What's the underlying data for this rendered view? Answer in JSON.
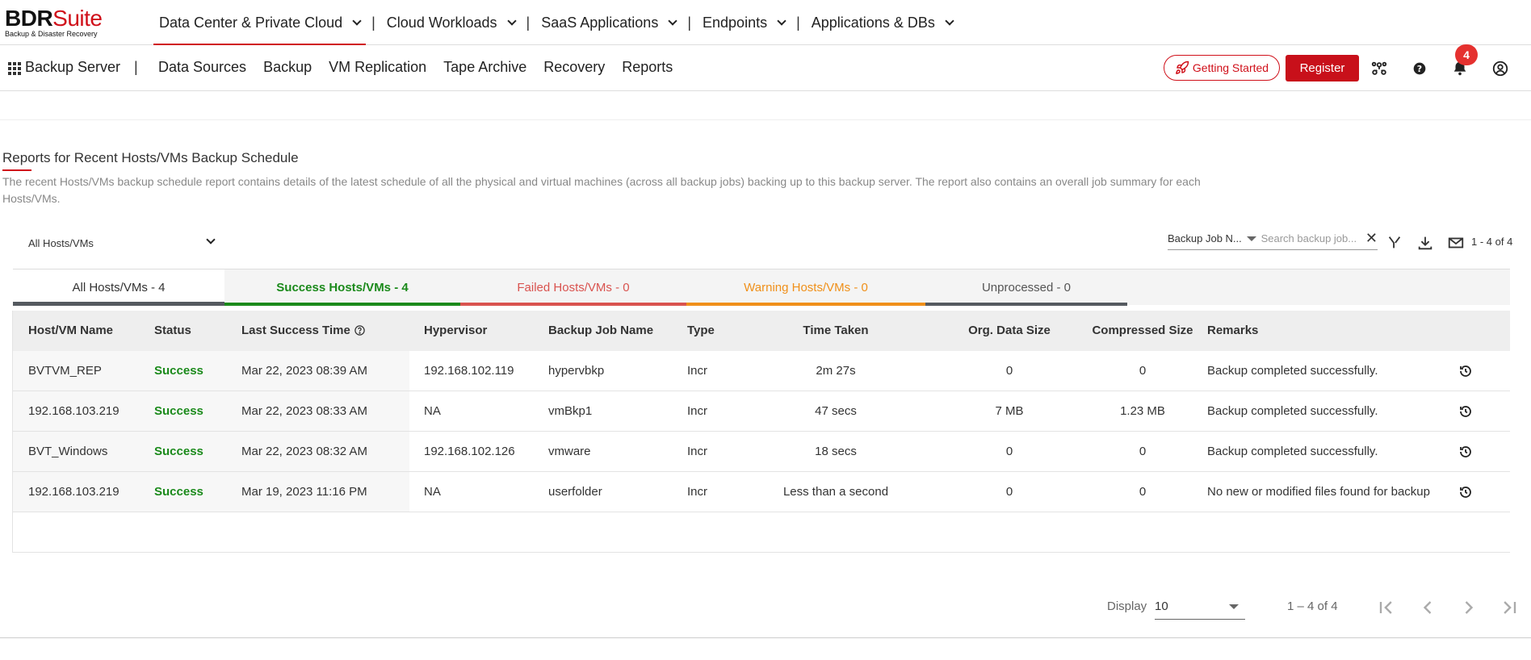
{
  "brand": {
    "name_part1": "BDR",
    "name_part2": "Suite",
    "tagline": "Backup & Disaster Recovery"
  },
  "topnav": [
    {
      "label": "Data Center & Private Cloud",
      "active": true
    },
    {
      "label": "Cloud Workloads"
    },
    {
      "label": "SaaS Applications"
    },
    {
      "label": "Endpoints"
    },
    {
      "label": "Applications & DBs"
    }
  ],
  "server": {
    "name": "Backup Server"
  },
  "secnav": [
    "Data Sources",
    "Backup",
    "VM Replication",
    "Tape Archive",
    "Recovery",
    "Reports"
  ],
  "header": {
    "getting_started": "Getting Started",
    "register": "Register",
    "notification_count": "4"
  },
  "page": {
    "title": "Reports for Recent Hosts/VMs Backup Schedule",
    "description": "The recent Hosts/VMs backup schedule report contains details of the latest schedule of all the physical and virtual machines (across all backup jobs) backing up to this backup server. The report also contains an overall job summary for each Hosts/VMs."
  },
  "filters": {
    "host_select": "All Hosts/VMs",
    "search_field": "Backup Job N...",
    "search_placeholder": "Search backup job...",
    "count": "1 - 4 of 4"
  },
  "tabs": [
    {
      "label": "All Hosts/VMs  - 4",
      "color": "#333333",
      "bar": "#555a60"
    },
    {
      "label": "Success Hosts/VMs  - 4",
      "color": "#1b8a1b",
      "bar": "#1b8a1b"
    },
    {
      "label": "Failed Hosts/VMs  - 0",
      "color": "#d9534f",
      "bar": "#d9534f"
    },
    {
      "label": "Warning Hosts/VMs  - 0",
      "color": "#f0901a",
      "bar": "#f0901a"
    },
    {
      "label": "Unprocessed  - 0",
      "color": "#555555",
      "bar": "#555a60"
    }
  ],
  "table": {
    "headers": [
      "Host/VM Name",
      "Status",
      "Last Success Time",
      "Hypervisor",
      "Backup Job Name",
      "Type",
      "Time Taken",
      "Org. Data Size",
      "Compressed Size",
      "Remarks"
    ],
    "rows": [
      [
        "BVTVM_REP",
        "Success",
        "Mar 22, 2023 08:39 AM",
        "192.168.102.119",
        "hypervbkp",
        "Incr",
        "2m 27s",
        "0",
        "0",
        "Backup completed successfully."
      ],
      [
        "192.168.103.219",
        "Success",
        "Mar 22, 2023 08:33 AM",
        "NA",
        "vmBkp1",
        "Incr",
        "47 secs",
        "7 MB",
        "1.23 MB",
        "Backup completed successfully."
      ],
      [
        "BVT_Windows",
        "Success",
        "Mar 22, 2023 08:32 AM",
        "192.168.102.126",
        "vmware",
        "Incr",
        "18 secs",
        "0",
        "0",
        "Backup completed successfully."
      ],
      [
        "192.168.103.219",
        "Success",
        "Mar 19, 2023 11:16 PM",
        "NA",
        "userfolder",
        "Incr",
        "Less than a second",
        "0",
        "0",
        "No new or modified files found for backup"
      ]
    ]
  },
  "pager": {
    "display_label": "Display",
    "page_size": "10",
    "range": "1 – 4 of 4"
  }
}
